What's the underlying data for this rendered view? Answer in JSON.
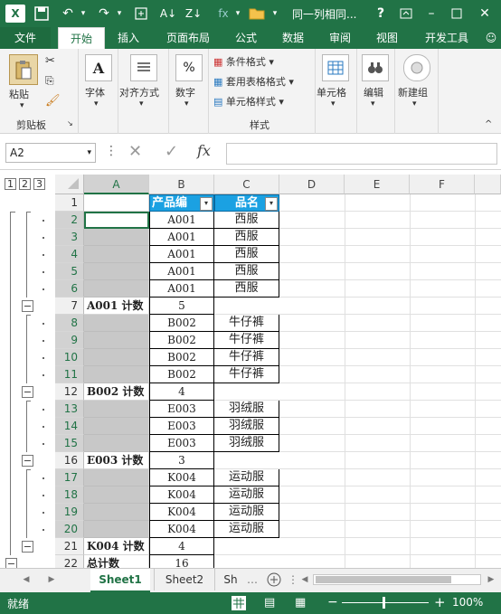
{
  "window": {
    "title": "同一列相同...",
    "help": "?"
  },
  "qat": {
    "app_icon": "excel-icon",
    "save_icon": "save-icon"
  },
  "tabs": [
    {
      "label": "文件"
    },
    {
      "label": "开始"
    },
    {
      "label": "插入"
    },
    {
      "label": "页面布局"
    },
    {
      "label": "公式"
    },
    {
      "label": "数据"
    },
    {
      "label": "审阅"
    },
    {
      "label": "视图"
    },
    {
      "label": "开发工具"
    }
  ],
  "ribbon": {
    "paste": "粘贴",
    "clipboard_group": "剪贴板",
    "font": "字体",
    "alignment": "对齐方式",
    "number": "数字",
    "number_symbol": "%",
    "conditional_format": "条件格式",
    "table_format": "套用表格格式",
    "cell_style": "单元格样式",
    "styles_group": "样式",
    "cells": "单元格",
    "editing": "编辑",
    "new_group": "新建组"
  },
  "formula_bar": {
    "name_box": "A2",
    "fx": "fx",
    "formula": ""
  },
  "outline_levels": [
    "1",
    "2",
    "3"
  ],
  "columns": [
    "A",
    "B",
    "C",
    "D",
    "E",
    "F"
  ],
  "header_row": {
    "row": "1",
    "b": "产品编",
    "c": "品名"
  },
  "rows": [
    {
      "row": "2",
      "a": "",
      "b": "A001",
      "c": "西服",
      "detail": true
    },
    {
      "row": "3",
      "a": "",
      "b": "A001",
      "c": "西服",
      "detail": true
    },
    {
      "row": "4",
      "a": "",
      "b": "A001",
      "c": "西服",
      "detail": true
    },
    {
      "row": "5",
      "a": "",
      "b": "A001",
      "c": "西服",
      "detail": true
    },
    {
      "row": "6",
      "a": "",
      "b": "A001",
      "c": "西服",
      "detail": true
    },
    {
      "row": "7",
      "a": "A001 计数",
      "b": "5",
      "c": "",
      "detail": false
    },
    {
      "row": "8",
      "a": "",
      "b": "B002",
      "c": "牛仔裤",
      "detail": true
    },
    {
      "row": "9",
      "a": "",
      "b": "B002",
      "c": "牛仔裤",
      "detail": true
    },
    {
      "row": "10",
      "a": "",
      "b": "B002",
      "c": "牛仔裤",
      "detail": true
    },
    {
      "row": "11",
      "a": "",
      "b": "B002",
      "c": "牛仔裤",
      "detail": true
    },
    {
      "row": "12",
      "a": "B002 计数",
      "b": "4",
      "c": "",
      "detail": false
    },
    {
      "row": "13",
      "a": "",
      "b": "E003",
      "c": "羽绒服",
      "detail": true
    },
    {
      "row": "14",
      "a": "",
      "b": "E003",
      "c": "羽绒服",
      "detail": true
    },
    {
      "row": "15",
      "a": "",
      "b": "E003",
      "c": "羽绒服",
      "detail": true
    },
    {
      "row": "16",
      "a": "E003 计数",
      "b": "3",
      "c": "",
      "detail": false
    },
    {
      "row": "17",
      "a": "",
      "b": "K004",
      "c": "运动服",
      "detail": true
    },
    {
      "row": "18",
      "a": "",
      "b": "K004",
      "c": "运动服",
      "detail": true
    },
    {
      "row": "19",
      "a": "",
      "b": "K004",
      "c": "运动服",
      "detail": true
    },
    {
      "row": "20",
      "a": "",
      "b": "K004",
      "c": "运动服",
      "detail": true
    },
    {
      "row": "21",
      "a": "K004 计数",
      "b": "4",
      "c": "",
      "detail": false
    },
    {
      "row": "22",
      "a": "总计数",
      "b": "16",
      "c": "",
      "detail": false
    }
  ],
  "sheets": [
    {
      "label": "Sheet1",
      "active": true
    },
    {
      "label": "Sheet2",
      "active": false
    },
    {
      "label": "Sh",
      "active": false
    }
  ],
  "status": {
    "ready": "就绪",
    "zoom": "100%"
  },
  "colors": {
    "excel_green": "#217346",
    "header_blue": "#1ba1e2",
    "grouped_cell_gray": "#c8c8c8"
  }
}
